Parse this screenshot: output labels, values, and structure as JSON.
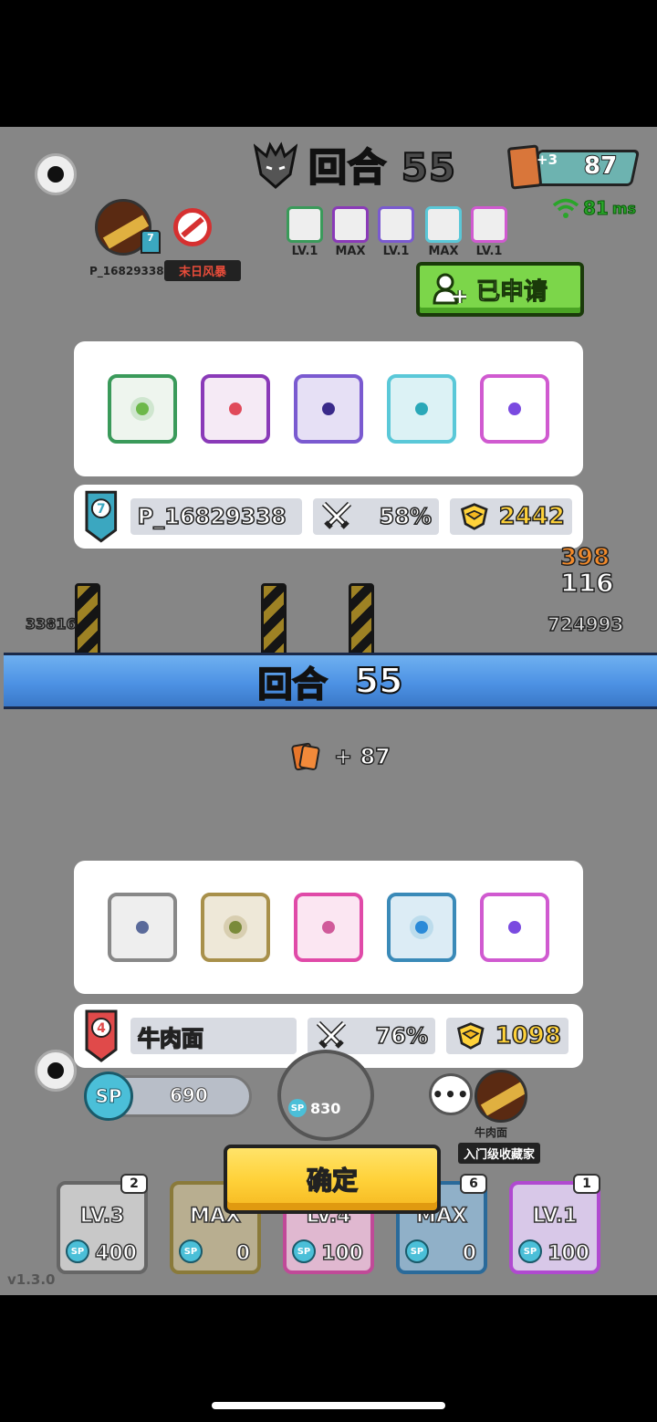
{
  "hud": {
    "round_title": "回合 55",
    "cards_count": "87",
    "cards_bonus": "+3",
    "ping_value": "81",
    "ping_unit": "ms"
  },
  "player_top": {
    "name": "P_16829338",
    "status_tag": "末日风暴",
    "avatar_badge": "7",
    "mini_deck_labels": [
      "LV.1",
      "MAX",
      "LV.1",
      "MAX",
      "LV.1"
    ]
  },
  "apply_button": {
    "label": "已申请"
  },
  "panel_top": {
    "player_name": "P_16829338",
    "rank": "7",
    "win_rate": "58%",
    "score": "2442"
  },
  "banner": {
    "label": "回合",
    "number": "55"
  },
  "float_numbers": [
    "398",
    "116",
    "724993",
    "33816"
  ],
  "gain": {
    "label": "+ 87"
  },
  "panel_bottom": {
    "player_name": "牛肉面",
    "rank": "4",
    "win_rate": "76%",
    "score": "1098"
  },
  "bottom": {
    "sp_label": "SP",
    "sp_value": "690",
    "roll_cost": "830",
    "roll_sp": "SP",
    "chat_icon_text": "•••",
    "opponent_name": "牛肉面",
    "opponent_title": "入门级收藏家",
    "confirm_label": "确定",
    "version": "v1.3.0",
    "slots": [
      {
        "level": "LV.3",
        "cost": "400",
        "count": "2"
      },
      {
        "level": "MAX",
        "cost": "0",
        "count": ""
      },
      {
        "level": "LV.4",
        "cost": "100",
        "count": ""
      },
      {
        "level": "MAX",
        "cost": "0",
        "count": "6"
      },
      {
        "level": "LV.1",
        "cost": "100",
        "count": "1"
      }
    ],
    "slot_sp": "SP"
  },
  "colors": {
    "apply_green": "#7cd64a",
    "banner_blue": "#4d92e4",
    "confirm_yellow": "#ffd23a",
    "score_gold": "#ffd23a"
  }
}
